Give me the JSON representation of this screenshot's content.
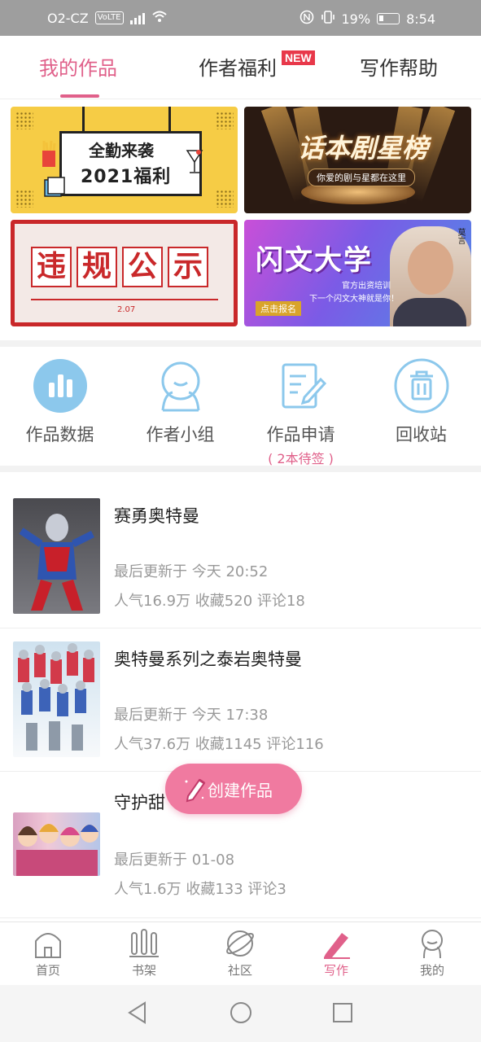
{
  "status_bar": {
    "carrier": "O2-CZ",
    "volte": "VoLTE",
    "battery": "19%",
    "time": "8:54"
  },
  "tabs": [
    {
      "label": "我的作品",
      "active": true
    },
    {
      "label": "作者福利",
      "badge": "NEW"
    },
    {
      "label": "写作帮助"
    }
  ],
  "banners": {
    "b1": {
      "line1": "全勤来袭",
      "line2": "2021福利"
    },
    "b2": {
      "title": "话本剧星榜",
      "subtitle": "你爱的剧与星都在这里"
    },
    "b3": {
      "chars": [
        "违",
        "规",
        "公",
        "示"
      ],
      "date": "2.07"
    },
    "b4": {
      "title": "闪文大学",
      "line1": "官方出资培训",
      "line2": "下一个闪文大神就是你！",
      "button": "点击报名",
      "name": "莫言"
    }
  },
  "quick_actions": [
    {
      "label": "作品数据",
      "icon": "bar-chart-icon"
    },
    {
      "label": "作者小组",
      "icon": "group-icon"
    },
    {
      "label": "作品申请",
      "sub": "( 2本待签 )",
      "icon": "edit-document-icon"
    },
    {
      "label": "回收站",
      "icon": "trash-icon"
    }
  ],
  "works": [
    {
      "title": "赛勇奥特曼",
      "updated": "最后更新于 今天 20:52",
      "stats": "人气16.9万 收藏520 评论18"
    },
    {
      "title": "奥特曼系列之泰岩奥特曼",
      "updated": "最后更新于 今天 17:38",
      "stats": "人气37.6万 收藏1145 评论116"
    },
    {
      "title": "守护甜",
      "updated": "最后更新于 01-08",
      "stats": "人气1.6万 收藏133 评论3"
    }
  ],
  "fab": {
    "label": "创建作品"
  },
  "bottom_nav": [
    {
      "label": "首页",
      "icon": "home-icon"
    },
    {
      "label": "书架",
      "icon": "bookshelf-icon"
    },
    {
      "label": "社区",
      "icon": "planet-icon"
    },
    {
      "label": "写作",
      "icon": "pen-icon",
      "active": true
    },
    {
      "label": "我的",
      "icon": "profile-icon"
    }
  ],
  "colors": {
    "accent": "#e0608a",
    "fab": "#f07aa0",
    "icon_blue": "#8cc8ec"
  }
}
